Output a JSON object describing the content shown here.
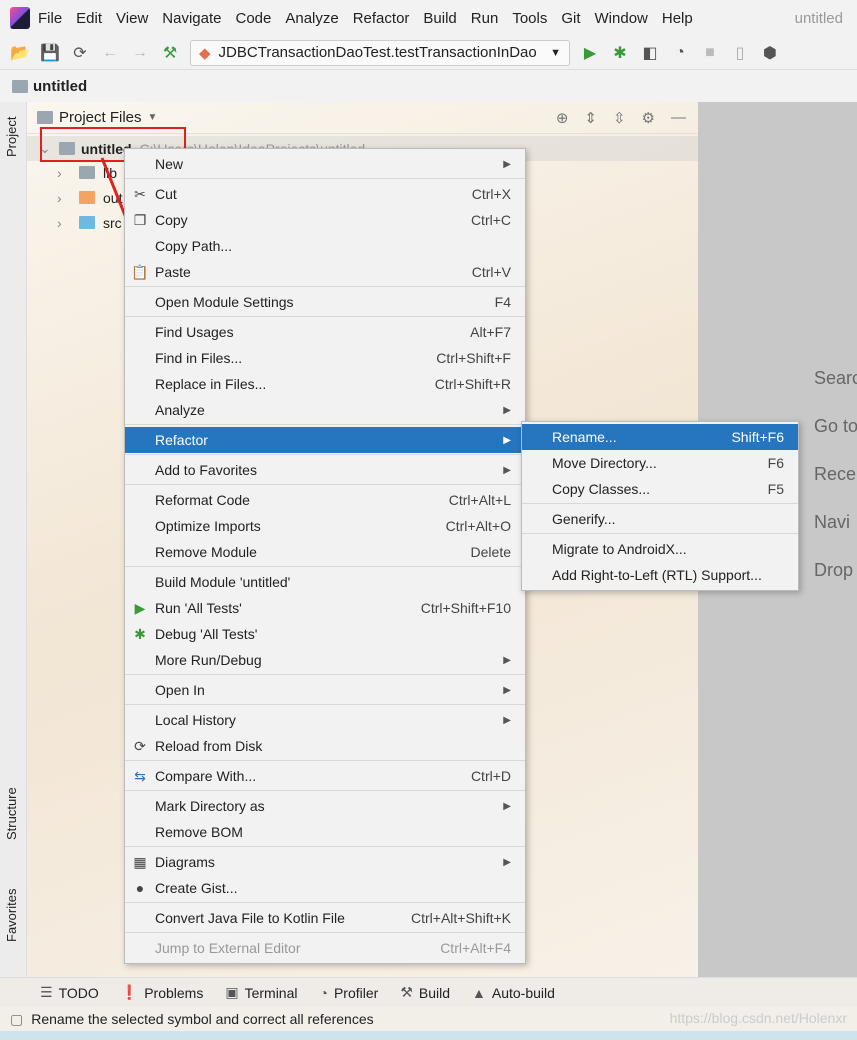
{
  "menubar": {
    "items": [
      "File",
      "Edit",
      "View",
      "Navigate",
      "Code",
      "Analyze",
      "Refactor",
      "Build",
      "Run",
      "Tools",
      "Git",
      "Window",
      "Help"
    ],
    "window_title": "untitled"
  },
  "toolbar": {
    "run_config": "JDBCTransactionDaoTest.testTransactionInDao"
  },
  "navbar": {
    "project": "untitled"
  },
  "tool_strip": {
    "project": "Project",
    "structure": "Structure",
    "favorites": "Favorites"
  },
  "panel": {
    "title": "Project Files",
    "root": "untitled",
    "root_path": "C:\\Users\\Holen\\IdeaProjects\\untitled",
    "children": [
      {
        "name": "lib",
        "color": "#9aa7b0"
      },
      {
        "name": "out",
        "color": "#f4a460"
      },
      {
        "name": "src",
        "color": "#6fb8e0"
      }
    ]
  },
  "editor_hints": [
    "Searc",
    "Go to",
    "Rece",
    "Navi",
    "Drop"
  ],
  "context_menu": [
    {
      "label": "New",
      "submenu": true
    },
    "sep",
    {
      "label": "Cut",
      "shortcut": "Ctrl+X",
      "icon": "scissors"
    },
    {
      "label": "Copy",
      "shortcut": "Ctrl+C",
      "icon": "copy"
    },
    {
      "label": "Copy Path..."
    },
    {
      "label": "Paste",
      "shortcut": "Ctrl+V",
      "icon": "clipboard"
    },
    "sep",
    {
      "label": "Open Module Settings",
      "shortcut": "F4"
    },
    "sep",
    {
      "label": "Find Usages",
      "shortcut": "Alt+F7"
    },
    {
      "label": "Find in Files...",
      "shortcut": "Ctrl+Shift+F"
    },
    {
      "label": "Replace in Files...",
      "shortcut": "Ctrl+Shift+R"
    },
    {
      "label": "Analyze",
      "submenu": true
    },
    "sep",
    {
      "label": "Refactor",
      "submenu": true,
      "selected": true
    },
    "sep",
    {
      "label": "Add to Favorites",
      "submenu": true
    },
    "sep",
    {
      "label": "Reformat Code",
      "shortcut": "Ctrl+Alt+L"
    },
    {
      "label": "Optimize Imports",
      "shortcut": "Ctrl+Alt+O"
    },
    {
      "label": "Remove Module",
      "shortcut": "Delete"
    },
    "sep",
    {
      "label": "Build Module 'untitled'"
    },
    {
      "label": "Run 'All Tests'",
      "shortcut": "Ctrl+Shift+F10",
      "icon": "run"
    },
    {
      "label": "Debug 'All Tests'",
      "icon": "bug"
    },
    {
      "label": "More Run/Debug",
      "submenu": true
    },
    "sep",
    {
      "label": "Open In",
      "submenu": true
    },
    "sep",
    {
      "label": "Local History",
      "submenu": true
    },
    {
      "label": "Reload from Disk",
      "icon": "reload"
    },
    "sep",
    {
      "label": "Compare With...",
      "shortcut": "Ctrl+D",
      "icon": "compare"
    },
    "sep",
    {
      "label": "Mark Directory as",
      "submenu": true
    },
    {
      "label": "Remove BOM"
    },
    "sep",
    {
      "label": "Diagrams",
      "submenu": true,
      "icon": "diagram"
    },
    {
      "label": "Create Gist...",
      "icon": "github"
    },
    "sep",
    {
      "label": "Convert Java File to Kotlin File",
      "shortcut": "Ctrl+Alt+Shift+K"
    },
    "sep",
    {
      "label": "Jump to External Editor",
      "shortcut": "Ctrl+Alt+F4",
      "disabled": true
    }
  ],
  "refactor_submenu": [
    {
      "label": "Rename...",
      "shortcut": "Shift+F6",
      "selected": true
    },
    {
      "label": "Move Directory...",
      "shortcut": "F6"
    },
    {
      "label": "Copy Classes...",
      "shortcut": "F5"
    },
    "sep",
    {
      "label": "Generify..."
    },
    "sep",
    {
      "label": "Migrate to AndroidX..."
    },
    {
      "label": "Add Right-to-Left (RTL) Support..."
    }
  ],
  "bottom_tabs": [
    "TODO",
    "Problems",
    "Terminal",
    "Profiler",
    "Build",
    "Auto-build"
  ],
  "status": {
    "message": "Rename the selected symbol and correct all references"
  },
  "watermark": "https://blog.csdn.net/Holenxr",
  "colors": {
    "selection": "#2675bf",
    "annotation": "#e02020"
  }
}
